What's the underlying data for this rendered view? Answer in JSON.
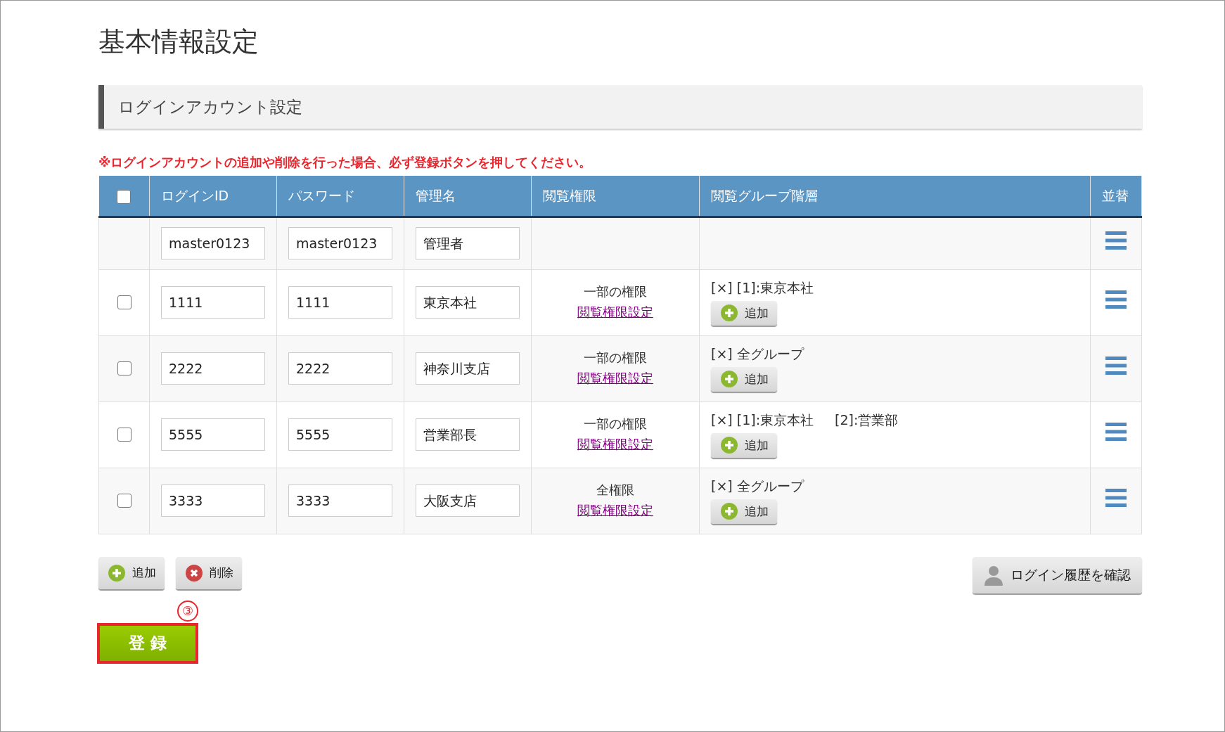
{
  "page_title": "基本情報設定",
  "section_title": "ログインアカウント設定",
  "notice": "※ログインアカウントの追加や削除を行った場合、必ず登録ボタンを押してください。",
  "table": {
    "select_all": {
      "checked": false
    },
    "columns": [
      "ログインID",
      "パスワード",
      "管理名",
      "閲覧権限",
      "閲覧グループ階層",
      "並替"
    ],
    "rows": [
      {
        "kind": "master",
        "login_id": "master0123",
        "password": "master0123",
        "name": "管理者"
      },
      {
        "kind": "account",
        "checked": false,
        "login_id": "1111",
        "password": "1111",
        "name": "東京本社",
        "permission": "一部の権限",
        "permission_link": "閲覧権限設定",
        "groups": [
          "[×] [1]:東京本社"
        ],
        "add_label": "追加"
      },
      {
        "kind": "account",
        "checked": false,
        "login_id": "2222",
        "password": "2222",
        "name": "神奈川支店",
        "permission": "一部の権限",
        "permission_link": "閲覧権限設定",
        "groups": [
          "[×] 全グループ"
        ],
        "add_label": "追加"
      },
      {
        "kind": "account",
        "checked": false,
        "login_id": "5555",
        "password": "5555",
        "name": "営業部長",
        "permission": "一部の権限",
        "permission_link": "閲覧権限設定",
        "groups": [
          "[×] [1]:東京本社",
          "[2]:営業部"
        ],
        "add_label": "追加"
      },
      {
        "kind": "account",
        "checked": false,
        "login_id": "3333",
        "password": "3333",
        "name": "大阪支店",
        "permission": "全権限",
        "permission_link": "閲覧権限設定",
        "groups": [
          "[×] 全グループ"
        ],
        "add_label": "追加"
      }
    ]
  },
  "buttons": {
    "add": "追加",
    "delete": "削除",
    "history": "ログイン履歴を確認"
  },
  "annotation": "③",
  "submit": {
    "label": "登 録",
    "highlighted": true
  }
}
